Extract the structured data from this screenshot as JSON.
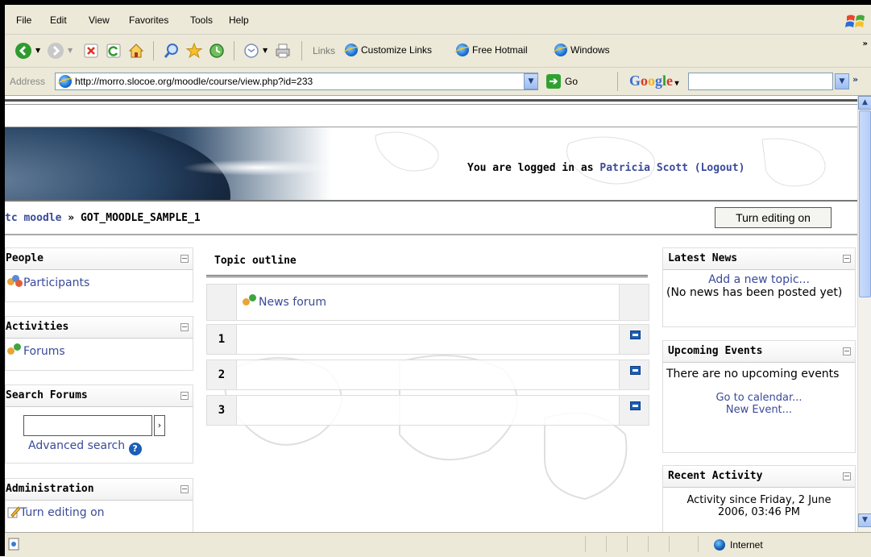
{
  "browser": {
    "menu": [
      "File",
      "Edit",
      "View",
      "Favorites",
      "Tools",
      "Help"
    ],
    "links_label": "Links",
    "links": [
      "Customize Links",
      "Free Hotmail",
      "Windows"
    ],
    "address_label": "Address",
    "url": "http://morro.slocoe.org/moodle/course/view.php?id=233",
    "go_label": "Go",
    "google_label": "Google",
    "status_zone": "Internet"
  },
  "header": {
    "login_prefix": "You are logged in as",
    "user_name": "Patricia Scott",
    "logout_label": "(Logout)"
  },
  "navbar": {
    "home": "tc moodle",
    "separator": "»",
    "course": "GOT_MOODLE_SAMPLE_1",
    "edit_button": "Turn editing on"
  },
  "left_blocks": {
    "people": {
      "title": "People",
      "participants": "Participants"
    },
    "activities": {
      "title": "Activities",
      "forums": "Forums"
    },
    "search": {
      "title": "Search Forums",
      "advanced": "Advanced search"
    },
    "admin": {
      "title": "Administration",
      "turn_editing_on": "Turn editing on"
    }
  },
  "main": {
    "title": "Topic outline",
    "news_forum": "News forum",
    "sections": [
      "1",
      "2",
      "3"
    ]
  },
  "right_blocks": {
    "news": {
      "title": "Latest News",
      "add_topic": "Add a new topic...",
      "empty": "(No news has been posted yet)"
    },
    "events": {
      "title": "Upcoming Events",
      "empty": "There are no upcoming events",
      "calendar": "Go to calendar...",
      "new_event": "New Event..."
    },
    "activity": {
      "title": "Recent Activity",
      "since": "Activity since Friday, 2 June 2006, 03:46 PM"
    }
  }
}
